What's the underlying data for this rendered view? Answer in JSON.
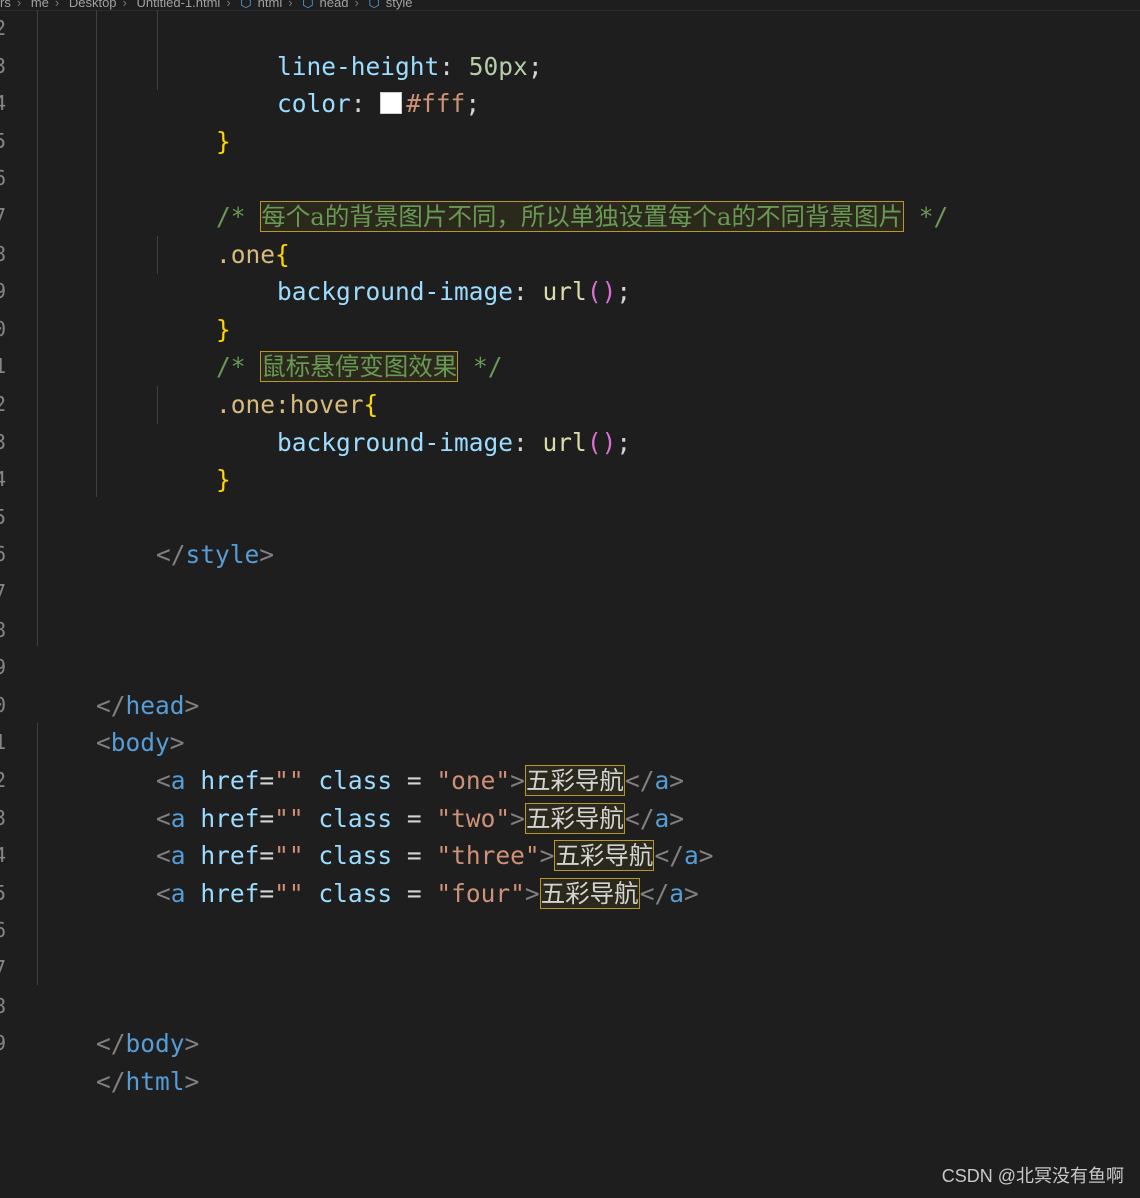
{
  "breadcrumb": [
    "rs",
    "me",
    "Desktop",
    "Untitled-1.html",
    "html",
    "head",
    "style"
  ],
  "gutter_numbers": [
    "2",
    "3",
    "4",
    "5",
    "6",
    "7",
    "8",
    "9",
    "0",
    "1",
    "2",
    "3",
    "4",
    "5",
    "6",
    "7",
    "8",
    "9",
    "0",
    "1",
    "2",
    "3",
    "4",
    "5",
    "6",
    "7",
    "8",
    "9"
  ],
  "code": {
    "l1_prop": "line-height",
    "l1_val": "50px",
    "l2_prop": "color",
    "l2_val": "#fff",
    "l3_close": "}",
    "l5_cmt_open": "/* ",
    "l5_cmt_text": "每个a的背景图片不同，所以单独设置每个a的不同背景图片",
    "l5_cmt_close": " */",
    "l6_sel": ".one",
    "l7_prop": "background-image",
    "l7_fn": "url",
    "l8_close": "}",
    "l9_cmt_open": "/* ",
    "l9_cmt_text": "鼠标悬停变图效果",
    "l9_cmt_close": " */",
    "l10_sel": ".one:hover",
    "l11_prop": "background-image",
    "l11_fn": "url",
    "l12_close": "}",
    "style_close_tag": "style",
    "head_close_tag": "head",
    "body_open_tag": "body",
    "links": [
      {
        "tag": "a",
        "attr_href": "href",
        "href_val": "\"\"",
        "attr_class": "class",
        "class_val": "\"one\"",
        "text": "五彩导航"
      },
      {
        "tag": "a",
        "attr_href": "href",
        "href_val": "\"\"",
        "attr_class": "class",
        "class_val": "\"two\"",
        "text": "五彩导航"
      },
      {
        "tag": "a",
        "attr_href": "href",
        "href_val": "\"\"",
        "attr_class": "class",
        "class_val": "\"three\"",
        "text": "五彩导航"
      },
      {
        "tag": "a",
        "attr_href": "href",
        "href_val": "\"\"",
        "attr_class": "class",
        "class_val": "\"four\"",
        "text": "五彩导航"
      }
    ],
    "body_close_tag": "body",
    "html_close_tag": "html"
  },
  "watermark": "CSDN @北冥没有鱼啊",
  "colors": {
    "background": "#1e1e1e",
    "property": "#9cdcfe",
    "number": "#b5cea8",
    "comment": "#6a9955",
    "selector": "#d7ba7d",
    "tag": "#569cd6",
    "string": "#ce9178",
    "brace": "#ffd700"
  }
}
